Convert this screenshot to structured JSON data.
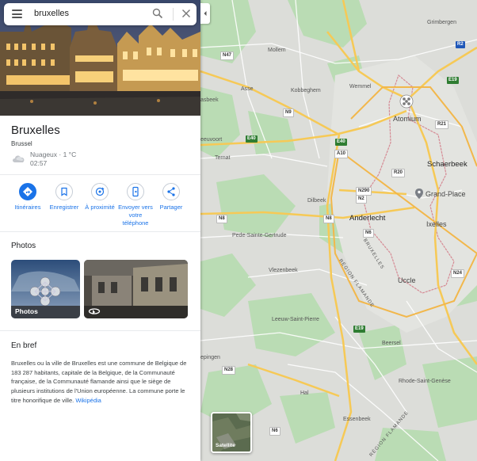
{
  "search": {
    "query": "bruxelles"
  },
  "place": {
    "title": "Bruxelles",
    "subtitle": "Brussel"
  },
  "weather": {
    "text": "Nuageux · 1 °C",
    "time": "02:57"
  },
  "actions": [
    {
      "label": "Itinéraires",
      "icon": "directions-icon"
    },
    {
      "label": "Enregistrer",
      "icon": "bookmark-icon"
    },
    {
      "label": "À proximité",
      "icon": "nearby-icon"
    },
    {
      "label": "Envoyer vers votre téléphone",
      "icon": "send-to-phone-icon"
    },
    {
      "label": "Partager",
      "icon": "share-icon"
    }
  ],
  "photos": {
    "heading": "Photos",
    "tiles": [
      {
        "label": "Photos"
      },
      {
        "label": "",
        "icon": "360-icon"
      }
    ]
  },
  "about": {
    "heading": "En bref",
    "text": "Bruxelles ou la ville de Bruxelles est une commune de Belgique de 183 287 habitants, capitale de la Belgique, de la Communauté française, de la Communauté flamande ainsi que le siège de plusieurs institutions de l'Union européenne. La commune porte le titre honorifique de ville.",
    "link": "Wikipédia"
  },
  "map": {
    "labels": {
      "grimbergen": "Grimbergen",
      "mollem": "Mollem",
      "asse": "Asse",
      "kobbeghem": "Kobbeghem",
      "wemmel": "Wemmel",
      "atomium": "Atomium",
      "schaerbeek": "Schaerbeek",
      "grandplace": "Grand-Place",
      "ternat": "Ternat",
      "dilbeek": "Dilbeek",
      "anderlecht": "Anderlecht",
      "ixelles": "Ixelles",
      "pede": "Pede-Sainte-Gertrude",
      "vlezenbeek": "Vlezenbeek",
      "uccle": "Uccle",
      "leeuw": "Leeuw-Saint-Pierre",
      "beersel": "Beersel",
      "rhode": "Rhode-Saint-Genèse",
      "hal": "Hal",
      "essenbeek": "Essenbeek",
      "aasbeek": "asbeek",
      "teuvoort": "eeuvoort",
      "pingen": "epingen",
      "bruxelles_road": "BRUXELLES",
      "region_flamande": "RÉGION FLAMANDE",
      "region_flamande2": "RÉGION FLAMANDE"
    },
    "shields": {
      "n47": "N47",
      "r2": "R2",
      "e19": "E19",
      "n9": "N9",
      "r21": "R21",
      "e40a": "E40",
      "e40b": "E40",
      "a10": "A10",
      "r20": "R20",
      "n290": "N290",
      "n2": "N2",
      "n8a": "N8",
      "n8b": "N8",
      "n6a": "N6",
      "n24": "N24",
      "e19b": "E19",
      "n28": "N28",
      "n6b": "N6"
    },
    "satellite_label": "Satellite"
  }
}
